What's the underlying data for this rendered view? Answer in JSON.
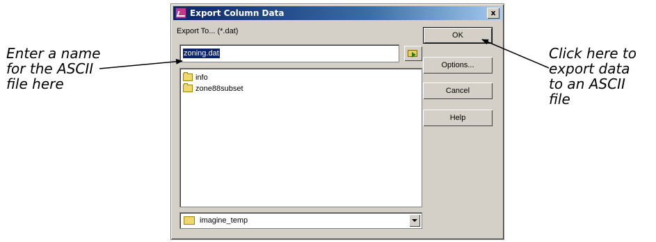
{
  "annotations": {
    "left": [
      "Enter a name",
      "for the ASCII",
      "file here"
    ],
    "right": [
      "Click here to",
      "export data",
      "to an ASCII",
      "file"
    ]
  },
  "dialog": {
    "title": "Export Column Data",
    "close_label": "x",
    "export_label": "Export To... (*.dat)",
    "filename_value": "zoning.dat",
    "file_list": [
      "info",
      "zone88subset"
    ],
    "directory": "imagine_temp",
    "buttons": {
      "ok": "OK",
      "options": "Options...",
      "cancel": "Cancel",
      "help": "Help"
    }
  }
}
